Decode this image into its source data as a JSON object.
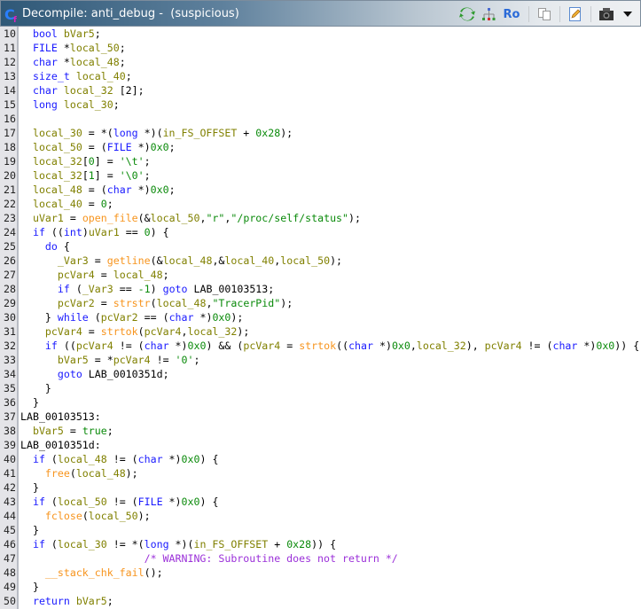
{
  "window": {
    "title": "Decompile: anti_debug -  (suspicious)",
    "toolbar": [
      {
        "name": "refresh-icon"
      },
      {
        "name": "graph-icon"
      },
      {
        "name": "read-only-icon",
        "label": "Ro"
      },
      {
        "name": "copy-icon"
      },
      {
        "name": "edit-icon"
      },
      {
        "name": "snapshot-icon"
      },
      {
        "name": "menu-dropdown-icon"
      }
    ]
  },
  "colors": {
    "keyword": "#1a1aff",
    "variable": "#808000",
    "function": "#f7941d",
    "constant": "#0a8a0a",
    "comment": "#9b30d9"
  },
  "lines": [
    {
      "n": "10",
      "t": [
        [
          "p",
          "  "
        ],
        [
          "k",
          "bool"
        ],
        [
          "p",
          " "
        ],
        [
          "v",
          "bVar5"
        ],
        [
          "p",
          ";"
        ]
      ]
    },
    {
      "n": "11",
      "t": [
        [
          "p",
          "  "
        ],
        [
          "k",
          "FILE"
        ],
        [
          "p",
          " *"
        ],
        [
          "v",
          "local_50"
        ],
        [
          "p",
          ";"
        ]
      ]
    },
    {
      "n": "12",
      "t": [
        [
          "p",
          "  "
        ],
        [
          "k",
          "char"
        ],
        [
          "p",
          " *"
        ],
        [
          "v",
          "local_48"
        ],
        [
          "p",
          ";"
        ]
      ]
    },
    {
      "n": "13",
      "t": [
        [
          "p",
          "  "
        ],
        [
          "k",
          "size_t"
        ],
        [
          "p",
          " "
        ],
        [
          "v",
          "local_40"
        ],
        [
          "p",
          ";"
        ]
      ]
    },
    {
      "n": "14",
      "t": [
        [
          "p",
          "  "
        ],
        [
          "k",
          "char"
        ],
        [
          "p",
          " "
        ],
        [
          "v",
          "local_32"
        ],
        [
          "p",
          " [2];"
        ]
      ]
    },
    {
      "n": "15",
      "t": [
        [
          "p",
          "  "
        ],
        [
          "k",
          "long"
        ],
        [
          "p",
          " "
        ],
        [
          "v",
          "local_30"
        ],
        [
          "p",
          ";"
        ]
      ]
    },
    {
      "n": "16",
      "t": []
    },
    {
      "n": "17",
      "t": [
        [
          "p",
          "  "
        ],
        [
          "v",
          "local_30"
        ],
        [
          "p",
          " = *("
        ],
        [
          "k",
          "long"
        ],
        [
          "p",
          " *)("
        ],
        [
          "v",
          "in_FS_OFFSET"
        ],
        [
          "p",
          " + "
        ],
        [
          "s",
          "0x28"
        ],
        [
          "p",
          ");"
        ]
      ]
    },
    {
      "n": "18",
      "t": [
        [
          "p",
          "  "
        ],
        [
          "v",
          "local_50"
        ],
        [
          "p",
          " = ("
        ],
        [
          "k",
          "FILE"
        ],
        [
          "p",
          " *)"
        ],
        [
          "s",
          "0x0"
        ],
        [
          "p",
          ";"
        ]
      ]
    },
    {
      "n": "19",
      "t": [
        [
          "p",
          "  "
        ],
        [
          "v",
          "local_32"
        ],
        [
          "p",
          "["
        ],
        [
          "s",
          "0"
        ],
        [
          "p",
          "] = "
        ],
        [
          "s",
          "'\\t'"
        ],
        [
          "p",
          ";"
        ]
      ]
    },
    {
      "n": "20",
      "t": [
        [
          "p",
          "  "
        ],
        [
          "v",
          "local_32"
        ],
        [
          "p",
          "["
        ],
        [
          "s",
          "1"
        ],
        [
          "p",
          "] = "
        ],
        [
          "s",
          "'\\0'"
        ],
        [
          "p",
          ";"
        ]
      ]
    },
    {
      "n": "21",
      "t": [
        [
          "p",
          "  "
        ],
        [
          "v",
          "local_48"
        ],
        [
          "p",
          " = ("
        ],
        [
          "k",
          "char"
        ],
        [
          "p",
          " *)"
        ],
        [
          "s",
          "0x0"
        ],
        [
          "p",
          ";"
        ]
      ]
    },
    {
      "n": "22",
      "t": [
        [
          "p",
          "  "
        ],
        [
          "v",
          "local_40"
        ],
        [
          "p",
          " = "
        ],
        [
          "s",
          "0"
        ],
        [
          "p",
          ";"
        ]
      ]
    },
    {
      "n": "23",
      "t": [
        [
          "p",
          "  "
        ],
        [
          "v",
          "uVar1"
        ],
        [
          "p",
          " = "
        ],
        [
          "f",
          "open_file"
        ],
        [
          "p",
          "(&"
        ],
        [
          "v",
          "local_50"
        ],
        [
          "p",
          ","
        ],
        [
          "s",
          "\"r\""
        ],
        [
          "p",
          ","
        ],
        [
          "s",
          "\"/proc/self/status\""
        ],
        [
          "p",
          ");"
        ]
      ]
    },
    {
      "n": "24",
      "t": [
        [
          "p",
          "  "
        ],
        [
          "k",
          "if"
        ],
        [
          "p",
          " (("
        ],
        [
          "k",
          "int"
        ],
        [
          "p",
          ")"
        ],
        [
          "v",
          "uVar1"
        ],
        [
          "p",
          " == "
        ],
        [
          "s",
          "0"
        ],
        [
          "p",
          ") {"
        ]
      ]
    },
    {
      "n": "25",
      "t": [
        [
          "p",
          "    "
        ],
        [
          "k",
          "do"
        ],
        [
          "p",
          " {"
        ]
      ]
    },
    {
      "n": "26",
      "t": [
        [
          "p",
          "      "
        ],
        [
          "v",
          "_Var3"
        ],
        [
          "p",
          " = "
        ],
        [
          "f",
          "getline"
        ],
        [
          "p",
          "(&"
        ],
        [
          "v",
          "local_48"
        ],
        [
          "p",
          ",&"
        ],
        [
          "v",
          "local_40"
        ],
        [
          "p",
          ","
        ],
        [
          "v",
          "local_50"
        ],
        [
          "p",
          ");"
        ]
      ]
    },
    {
      "n": "27",
      "t": [
        [
          "p",
          "      "
        ],
        [
          "v",
          "pcVar4"
        ],
        [
          "p",
          " = "
        ],
        [
          "v",
          "local_48"
        ],
        [
          "p",
          ";"
        ]
      ]
    },
    {
      "n": "28",
      "t": [
        [
          "p",
          "      "
        ],
        [
          "k",
          "if"
        ],
        [
          "p",
          " ("
        ],
        [
          "v",
          "_Var3"
        ],
        [
          "p",
          " == "
        ],
        [
          "s",
          "-1"
        ],
        [
          "p",
          ") "
        ],
        [
          "k",
          "goto"
        ],
        [
          "p",
          " "
        ],
        [
          "l",
          "LAB_00103513"
        ],
        [
          "p",
          ";"
        ]
      ]
    },
    {
      "n": "29",
      "t": [
        [
          "p",
          "      "
        ],
        [
          "v",
          "pcVar2"
        ],
        [
          "p",
          " = "
        ],
        [
          "f",
          "strstr"
        ],
        [
          "p",
          "("
        ],
        [
          "v",
          "local_48"
        ],
        [
          "p",
          ","
        ],
        [
          "s",
          "\"TracerPid\""
        ],
        [
          "p",
          ");"
        ]
      ]
    },
    {
      "n": "30",
      "t": [
        [
          "p",
          "    } "
        ],
        [
          "k",
          "while"
        ],
        [
          "p",
          " ("
        ],
        [
          "v",
          "pcVar2"
        ],
        [
          "p",
          " == ("
        ],
        [
          "k",
          "char"
        ],
        [
          "p",
          " *)"
        ],
        [
          "s",
          "0x0"
        ],
        [
          "p",
          ");"
        ]
      ]
    },
    {
      "n": "31",
      "t": [
        [
          "p",
          "    "
        ],
        [
          "v",
          "pcVar4"
        ],
        [
          "p",
          " = "
        ],
        [
          "f",
          "strtok"
        ],
        [
          "p",
          "("
        ],
        [
          "v",
          "pcVar4"
        ],
        [
          "p",
          ","
        ],
        [
          "v",
          "local_32"
        ],
        [
          "p",
          ");"
        ]
      ]
    },
    {
      "n": "32",
      "t": [
        [
          "p",
          "    "
        ],
        [
          "k",
          "if"
        ],
        [
          "p",
          " (("
        ],
        [
          "v",
          "pcVar4"
        ],
        [
          "p",
          " != ("
        ],
        [
          "k",
          "char"
        ],
        [
          "p",
          " *)"
        ],
        [
          "s",
          "0x0"
        ],
        [
          "p",
          ") && ("
        ],
        [
          "v",
          "pcVar4"
        ],
        [
          "p",
          " = "
        ],
        [
          "f",
          "strtok"
        ],
        [
          "p",
          "(("
        ],
        [
          "k",
          "char"
        ],
        [
          "p",
          " *)"
        ],
        [
          "s",
          "0x0"
        ],
        [
          "p",
          ","
        ],
        [
          "v",
          "local_32"
        ],
        [
          "p",
          "), "
        ],
        [
          "v",
          "pcVar4"
        ],
        [
          "p",
          " != ("
        ],
        [
          "k",
          "char"
        ],
        [
          "p",
          " *)"
        ],
        [
          "s",
          "0x0"
        ],
        [
          "p",
          ")) {"
        ]
      ]
    },
    {
      "n": "33",
      "t": [
        [
          "p",
          "      "
        ],
        [
          "v",
          "bVar5"
        ],
        [
          "p",
          " = *"
        ],
        [
          "v",
          "pcVar4"
        ],
        [
          "p",
          " != "
        ],
        [
          "s",
          "'0'"
        ],
        [
          "p",
          ";"
        ]
      ]
    },
    {
      "n": "34",
      "t": [
        [
          "p",
          "      "
        ],
        [
          "k",
          "goto"
        ],
        [
          "p",
          " "
        ],
        [
          "l",
          "LAB_0010351d"
        ],
        [
          "p",
          ";"
        ]
      ]
    },
    {
      "n": "35",
      "t": [
        [
          "p",
          "    }"
        ]
      ]
    },
    {
      "n": "36",
      "t": [
        [
          "p",
          "  }"
        ]
      ]
    },
    {
      "n": "37",
      "t": [
        [
          "l",
          "LAB_00103513"
        ],
        [
          "p",
          ":"
        ]
      ]
    },
    {
      "n": "38",
      "t": [
        [
          "p",
          "  "
        ],
        [
          "v",
          "bVar5"
        ],
        [
          "p",
          " = "
        ],
        [
          "s",
          "true"
        ],
        [
          "p",
          ";"
        ]
      ]
    },
    {
      "n": "39",
      "t": [
        [
          "l",
          "LAB_0010351d"
        ],
        [
          "p",
          ":"
        ]
      ]
    },
    {
      "n": "40",
      "t": [
        [
          "p",
          "  "
        ],
        [
          "k",
          "if"
        ],
        [
          "p",
          " ("
        ],
        [
          "v",
          "local_48"
        ],
        [
          "p",
          " != ("
        ],
        [
          "k",
          "char"
        ],
        [
          "p",
          " *)"
        ],
        [
          "s",
          "0x0"
        ],
        [
          "p",
          ") {"
        ]
      ]
    },
    {
      "n": "41",
      "t": [
        [
          "p",
          "    "
        ],
        [
          "f",
          "free"
        ],
        [
          "p",
          "("
        ],
        [
          "v",
          "local_48"
        ],
        [
          "p",
          ");"
        ]
      ]
    },
    {
      "n": "42",
      "t": [
        [
          "p",
          "  }"
        ]
      ]
    },
    {
      "n": "43",
      "t": [
        [
          "p",
          "  "
        ],
        [
          "k",
          "if"
        ],
        [
          "p",
          " ("
        ],
        [
          "v",
          "local_50"
        ],
        [
          "p",
          " != ("
        ],
        [
          "k",
          "FILE"
        ],
        [
          "p",
          " *)"
        ],
        [
          "s",
          "0x0"
        ],
        [
          "p",
          ") {"
        ]
      ]
    },
    {
      "n": "44",
      "t": [
        [
          "p",
          "    "
        ],
        [
          "f",
          "fclose"
        ],
        [
          "p",
          "("
        ],
        [
          "v",
          "local_50"
        ],
        [
          "p",
          ");"
        ]
      ]
    },
    {
      "n": "45",
      "t": [
        [
          "p",
          "  }"
        ]
      ]
    },
    {
      "n": "46",
      "t": [
        [
          "p",
          "  "
        ],
        [
          "k",
          "if"
        ],
        [
          "p",
          " ("
        ],
        [
          "v",
          "local_30"
        ],
        [
          "p",
          " != *("
        ],
        [
          "k",
          "long"
        ],
        [
          "p",
          " *)("
        ],
        [
          "v",
          "in_FS_OFFSET"
        ],
        [
          "p",
          " + "
        ],
        [
          "s",
          "0x28"
        ],
        [
          "p",
          ")) {"
        ]
      ]
    },
    {
      "n": "47",
      "t": [
        [
          "p",
          "                    "
        ],
        [
          "c",
          "/* WARNING: Subroutine does not return */"
        ]
      ]
    },
    {
      "n": "48",
      "t": [
        [
          "p",
          "    "
        ],
        [
          "f",
          "__stack_chk_fail"
        ],
        [
          "p",
          "();"
        ]
      ]
    },
    {
      "n": "49",
      "t": [
        [
          "p",
          "  }"
        ]
      ]
    },
    {
      "n": "50",
      "t": [
        [
          "p",
          "  "
        ],
        [
          "k",
          "return"
        ],
        [
          "p",
          " "
        ],
        [
          "v",
          "bVar5"
        ],
        [
          "p",
          ";"
        ]
      ]
    }
  ]
}
